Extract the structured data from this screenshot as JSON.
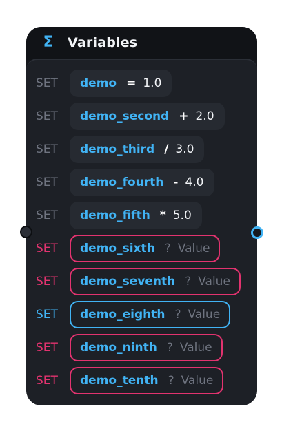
{
  "node": {
    "title": "Variables",
    "icon": "sigma-icon",
    "accent_blue": "#41b3f4",
    "accent_pink": "#e2336f"
  },
  "rows": [
    {
      "set": "SET",
      "name": "demo",
      "op": "=",
      "value": "1.0"
    },
    {
      "set": "SET",
      "name": "demo_second",
      "op": "+",
      "value": "2.0"
    },
    {
      "set": "SET",
      "name": "demo_third",
      "op": "/",
      "value": "3.0"
    },
    {
      "set": "SET",
      "name": "demo_fourth",
      "op": "-",
      "value": "4.0"
    },
    {
      "set": "SET",
      "name": "demo_fifth",
      "op": "*",
      "value": "5.0"
    },
    {
      "set": "SET",
      "name": "demo_sixth",
      "op": "?",
      "value": "Value"
    },
    {
      "set": "SET",
      "name": "demo_seventh",
      "op": "?",
      "value": "Value"
    },
    {
      "set": "SET",
      "name": "demo_eighth",
      "op": "?",
      "value": "Value"
    },
    {
      "set": "SET",
      "name": "demo_ninth",
      "op": "?",
      "value": "Value"
    },
    {
      "set": "SET",
      "name": "demo_tenth",
      "op": "?",
      "value": "Value"
    }
  ]
}
